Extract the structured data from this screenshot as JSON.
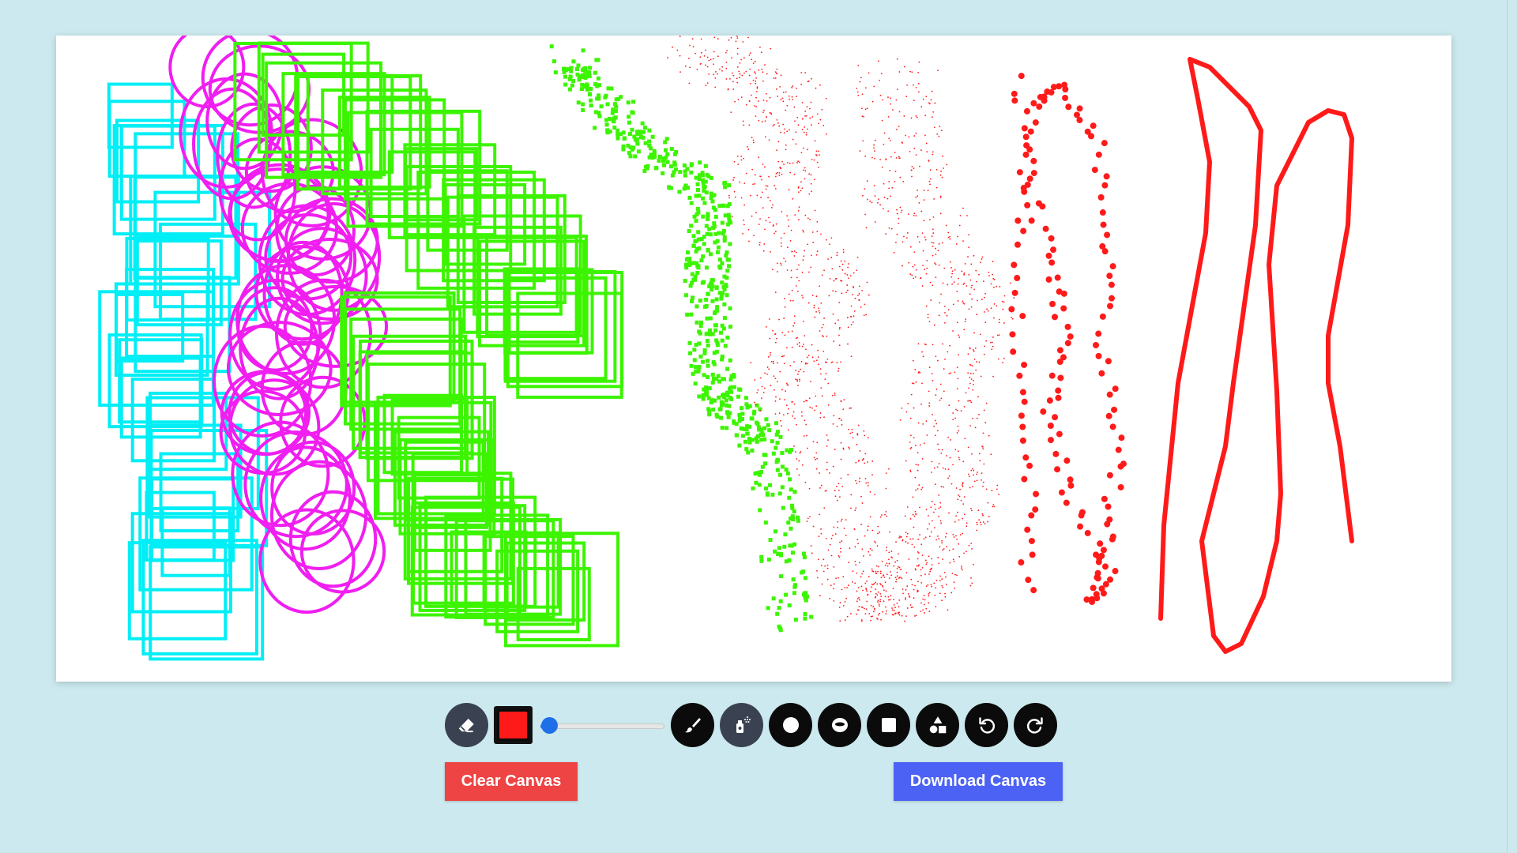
{
  "colors": {
    "page_background": "#cbe9ee",
    "canvas_background": "#ffffff",
    "selected_color": "#ff1a1a",
    "clear_button": "#ee4444",
    "download_button": "#4c62f5",
    "cyan_stroke": "#00eef5",
    "magenta_stroke": "#f01ef0",
    "green_stroke": "#3cf400",
    "red_stroke": "#ff1a1a"
  },
  "toolbar": {
    "brush_size_percent": 7,
    "tools": [
      {
        "icon": "eraser-icon",
        "name": "eraser"
      },
      {
        "icon": "brush-icon",
        "name": "brush"
      },
      {
        "icon": "spray-icon",
        "name": "spray"
      },
      {
        "icon": "circle-icon",
        "name": "circle"
      },
      {
        "icon": "ring-icon",
        "name": "ring"
      },
      {
        "icon": "square-icon",
        "name": "square"
      },
      {
        "icon": "shapes-icon",
        "name": "shapes"
      },
      {
        "icon": "undo-icon",
        "name": "undo"
      },
      {
        "icon": "redo-icon",
        "name": "redo"
      }
    ]
  },
  "actions": {
    "clear_label": "Clear Canvas",
    "download_label": "Download Canvas"
  }
}
